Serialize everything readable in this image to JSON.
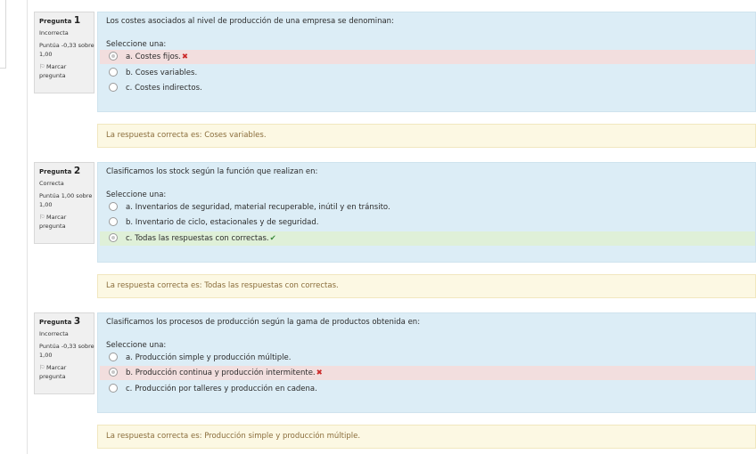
{
  "questions": [
    {
      "label": "Pregunta",
      "number": "1",
      "state": "Incorrecta",
      "grade": "Puntúa -0,33 sobre 1,00",
      "flag": "Marcar pregunta",
      "text": "Los costes asociados al nivel de producción de una empresa se denominan:",
      "prompt": "Seleccione una:",
      "options": [
        {
          "label": "a. Costes fijos.",
          "checked": true,
          "status": "incorrect"
        },
        {
          "label": "b. Coses variables.",
          "checked": false,
          "status": ""
        },
        {
          "label": "c. Costes indirectos.",
          "checked": false,
          "status": ""
        }
      ],
      "feedback": "La respuesta correcta es: Coses variables."
    },
    {
      "label": "Pregunta",
      "number": "2",
      "state": "Correcta",
      "grade": "Puntúa 1,00 sobre 1,00",
      "flag": "Marcar pregunta",
      "text": "Clasificamos los stock según la función que realizan en:",
      "prompt": "Seleccione una:",
      "options": [
        {
          "label": "a. Inventarios de seguridad, material recuperable, inútil y en tránsito.",
          "checked": false,
          "status": ""
        },
        {
          "label": "b. Inventario de ciclo, estacionales y de seguridad.",
          "checked": false,
          "status": ""
        },
        {
          "label": "c. Todas las respuestas con correctas.",
          "checked": true,
          "status": "correct"
        }
      ],
      "feedback": "La respuesta correcta es: Todas las respuestas con correctas."
    },
    {
      "label": "Pregunta",
      "number": "3",
      "state": "Incorrecta",
      "grade": "Puntúa -0,33 sobre 1,00",
      "flag": "Marcar pregunta",
      "text": "Clasificamos los procesos de producción según la gama de productos obtenida en:",
      "prompt": "Seleccione una:",
      "options": [
        {
          "label": "a. Producción simple y producción múltiple.",
          "checked": false,
          "status": ""
        },
        {
          "label": "b. Producción continua y producción intermitente.",
          "checked": true,
          "status": "incorrect"
        },
        {
          "label": "c. Producción por talleres y producción en cadena.",
          "checked": false,
          "status": ""
        }
      ],
      "feedback": "La respuesta correcta es: Producción simple y producción múltiple."
    }
  ],
  "icons": {
    "incorrect": "cross-icon",
    "correct": "check-icon",
    "flag": "flag-icon"
  },
  "colors": {
    "formulation_bg": "#dcedf6",
    "incorrect_bg": "#f2dede",
    "correct_bg": "#dff0d8",
    "feedback_bg": "#fcf8e3",
    "incorrect_mark": "#cc2a2a",
    "correct_mark": "#3c8a3c"
  }
}
